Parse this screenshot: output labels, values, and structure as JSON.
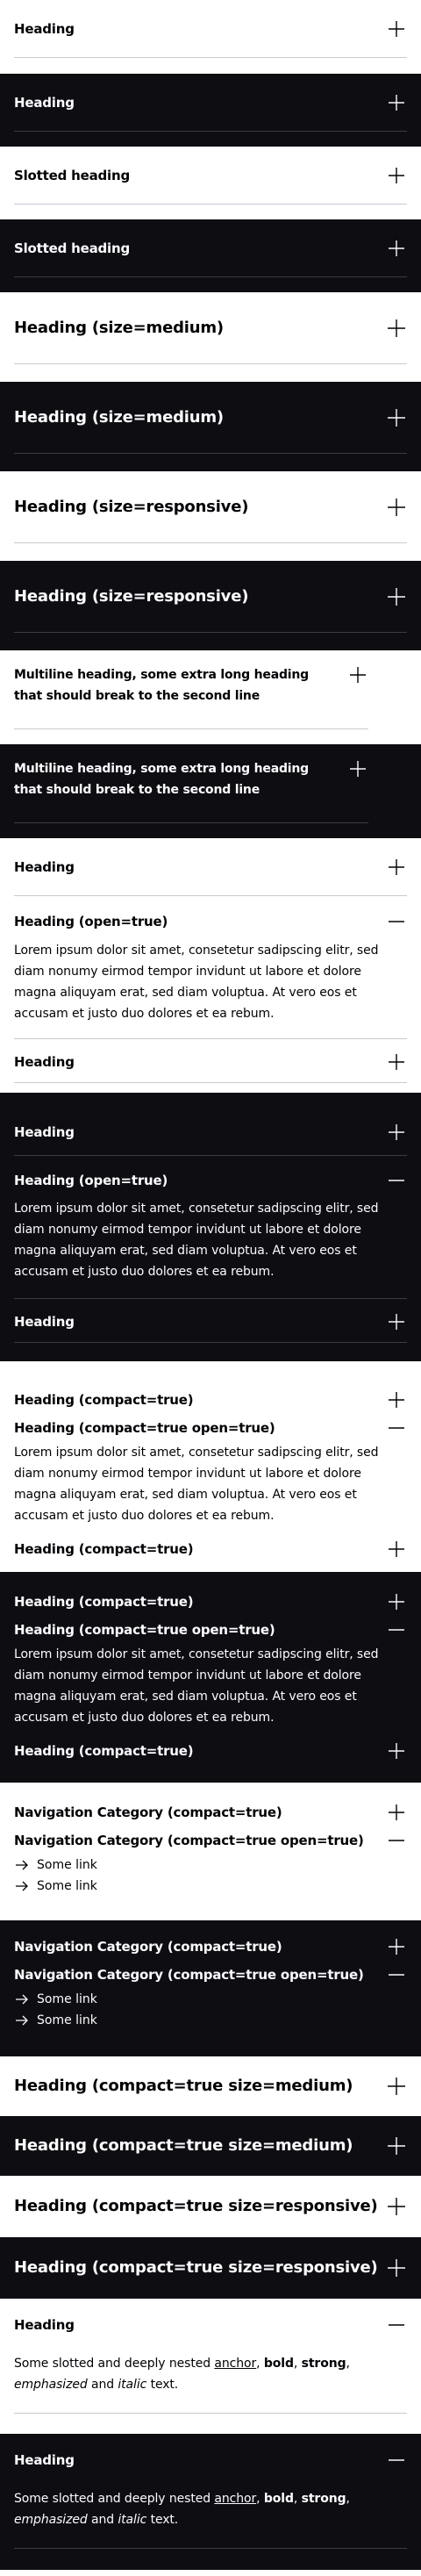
{
  "items": {
    "heading": "Heading",
    "slotted_heading": "Slotted heading",
    "heading_size_medium": "Heading (size=medium)",
    "heading_size_responsive": "Heading (size=responsive)",
    "multiline_heading": "Multiline heading, some extra long heading that should break to the second line",
    "heading_open": "Heading (open=true)",
    "heading_compact": "Heading (compact=true)",
    "heading_compact_open": "Heading (compact=true open=true)",
    "nav_category_compact": "Navigation Category (compact=true)",
    "nav_category_compact_open": "Navigation Category (compact=true open=true)",
    "heading_compact_size_medium": "Heading (compact=true size=medium)",
    "heading_compact_size_responsive": "Heading (compact=true size=responsive)"
  },
  "content": {
    "lorem": "Lorem ipsum dolor sit amet, consetetur sadipscing elitr, sed diam nonumy eirmod tempor invidunt ut labore et dolore magna aliquyam erat, sed diam voluptua. At vero eos et accusam et justo duo dolores et ea rebum.",
    "link_1": "Some link",
    "link_2": "Some link",
    "slotted_prefix": "Some slotted and deeply nested ",
    "anchor": "anchor",
    "comma_1": ", ",
    "bold": "bold",
    "comma_2": ", ",
    "strong": "strong",
    "comma_3": ", ",
    "emphasized": "emphasized",
    "and": " and ",
    "italic": "italic",
    "text_end": " text."
  },
  "icons": {
    "expand": "plus-icon",
    "collapse": "minus-icon",
    "link": "arrow-right-icon"
  },
  "colors": {
    "light_bg": "#ffffff",
    "dark_bg": "#0e0e12",
    "light_text": "#010205",
    "dark_text": "#fbfcff"
  }
}
